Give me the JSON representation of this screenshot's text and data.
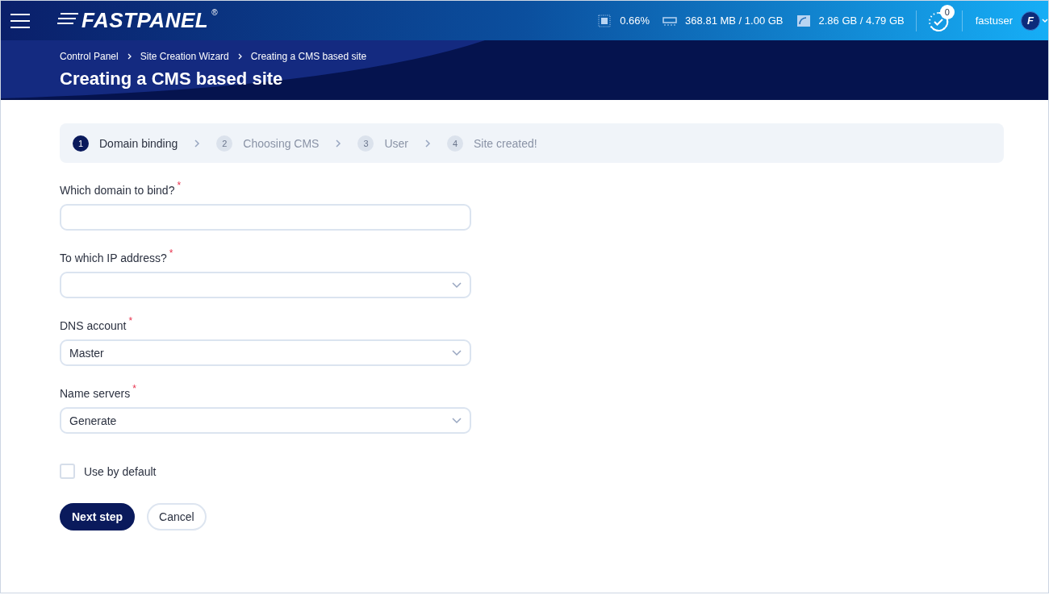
{
  "topbar": {
    "logo": "FASTPANEL",
    "logo_mark": "®",
    "stats": [
      {
        "kind": "cpu",
        "text": "0.66%"
      },
      {
        "kind": "ram",
        "text": "368.81 MB / 1.00 GB"
      },
      {
        "kind": "disk",
        "text": "2.86 GB / 4.79 GB"
      }
    ],
    "tasks_badge": "0",
    "user": "fastuser",
    "avatar_letter": "F"
  },
  "breadcrumbs": [
    {
      "label": "Control Panel"
    },
    {
      "label": "Site Creation Wizard"
    },
    {
      "label": "Creating a CMS based site"
    }
  ],
  "page_title": "Creating a CMS based site",
  "steps": [
    {
      "number": "1",
      "label": "Domain binding",
      "selected": true
    },
    {
      "number": "2",
      "label": "Choosing CMS",
      "selected": false
    },
    {
      "number": "3",
      "label": "User",
      "selected": false
    },
    {
      "number": "4",
      "label": "Site created!",
      "selected": false
    }
  ],
  "fields": [
    {
      "kind": "text",
      "label": "Which domain to bind?",
      "required_mark": "*"
    },
    {
      "kind": "select",
      "label": "To which IP address?",
      "required_mark": "*"
    },
    {
      "kind": "select",
      "label": "DNS account",
      "required_mark": "*",
      "value": "Master"
    },
    {
      "kind": "select",
      "label": "Name servers",
      "required_mark": "*",
      "value": "Generate"
    }
  ],
  "checkbox": {
    "label": "Use by default",
    "checked": false
  },
  "buttons": [
    {
      "kind": "primary",
      "label": "Next step"
    },
    {
      "kind": "secondary",
      "label": "Cancel"
    }
  ]
}
